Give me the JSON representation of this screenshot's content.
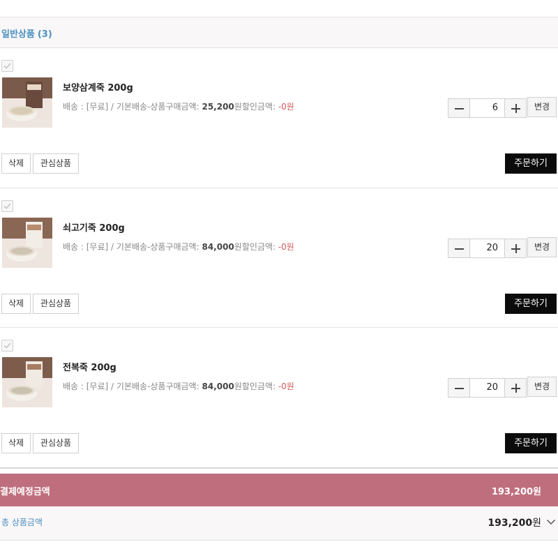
{
  "section": {
    "title": "일반상품",
    "count": "(3)"
  },
  "items": [
    {
      "name": "보양삼계죽 200g",
      "shipping_prefix": "배송 : [무료] / 기본배송-상품구매금액: ",
      "amount": "25,200",
      "amount_suffix": "원할인금액: ",
      "discount": "-0원",
      "quantity": "6",
      "change_label": "변경",
      "delete_label": "삭제",
      "wish_label": "관심상품",
      "order_label": "주문하기"
    },
    {
      "name": "쇠고기죽 200g",
      "shipping_prefix": "배송 : [무료] / 기본배송-상품구매금액: ",
      "amount": "84,000",
      "amount_suffix": "원할인금액: ",
      "discount": "-0원",
      "quantity": "20",
      "change_label": "변경",
      "delete_label": "삭제",
      "wish_label": "관심상품",
      "order_label": "주문하기"
    },
    {
      "name": "전복죽 200g",
      "shipping_prefix": "배송 : [무료] / 기본배송-상품구매금액: ",
      "amount": "84,000",
      "amount_suffix": "원할인금액: ",
      "discount": "-0원",
      "quantity": "20",
      "change_label": "변경",
      "delete_label": "삭제",
      "wish_label": "관심상품",
      "order_label": "주문하기"
    }
  ],
  "totals": {
    "payment_label": "결제예정금액",
    "payment_value": "193,200원",
    "product_total_label": "총 상품금액",
    "product_total_value": "193,200",
    "product_total_unit": "원"
  },
  "colors": {
    "section_title": "#4a8fc0",
    "total_bar": "#bf6e7d",
    "order_button": "#0b0b0b",
    "discount": "#d05a5a"
  }
}
